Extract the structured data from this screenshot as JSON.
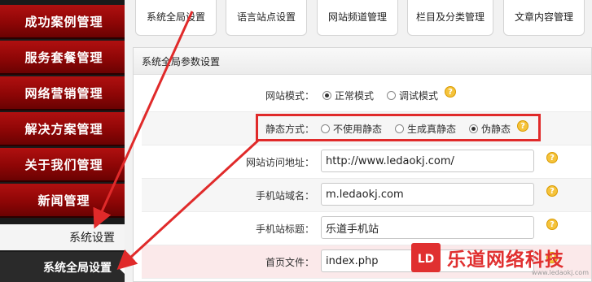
{
  "sidebar": {
    "items": [
      {
        "label": "成功案例管理"
      },
      {
        "label": "服务套餐管理"
      },
      {
        "label": "网络营销管理"
      },
      {
        "label": "解决方案管理"
      },
      {
        "label": "关于我们管理"
      },
      {
        "label": "新闻管理"
      }
    ],
    "sub_label": "系统设置",
    "active_label": "系统全局设置"
  },
  "tabs": [
    {
      "label": "系统全局设置"
    },
    {
      "label": "语言站点设置"
    },
    {
      "label": "网站频道管理"
    },
    {
      "label": "栏目及分类管理"
    },
    {
      "label": "文章内容管理"
    }
  ],
  "panel": {
    "title": "系统全局参数设置",
    "site_mode": {
      "label": "网站模式：",
      "options": [
        {
          "label": "正常模式",
          "selected": true
        },
        {
          "label": "调试模式",
          "selected": false
        }
      ]
    },
    "static_mode": {
      "label": "静态方式：",
      "options": [
        {
          "label": "不使用静态",
          "selected": false
        },
        {
          "label": "生成真静态",
          "selected": false
        },
        {
          "label": "伪静态",
          "selected": true
        }
      ]
    },
    "site_url": {
      "label": "网站访问地址：",
      "value": "http://www.ledaokj.com/"
    },
    "mobile_domain": {
      "label": "手机站域名：",
      "value": "m.ledaokj.com"
    },
    "mobile_title": {
      "label": "手机站标题：",
      "value": "乐道手机站"
    },
    "index_file": {
      "label": "首页文件：",
      "value": "index.php"
    },
    "help_glyph": "?"
  },
  "watermark": {
    "brand": "乐道网络科技",
    "url": "www.ledaokj.com",
    "logo_glyph": "LD"
  },
  "colors": {
    "sidebar_red": "#9a0808",
    "highlight_red": "#e02a2a",
    "help_yellow": "#f5c33b"
  }
}
